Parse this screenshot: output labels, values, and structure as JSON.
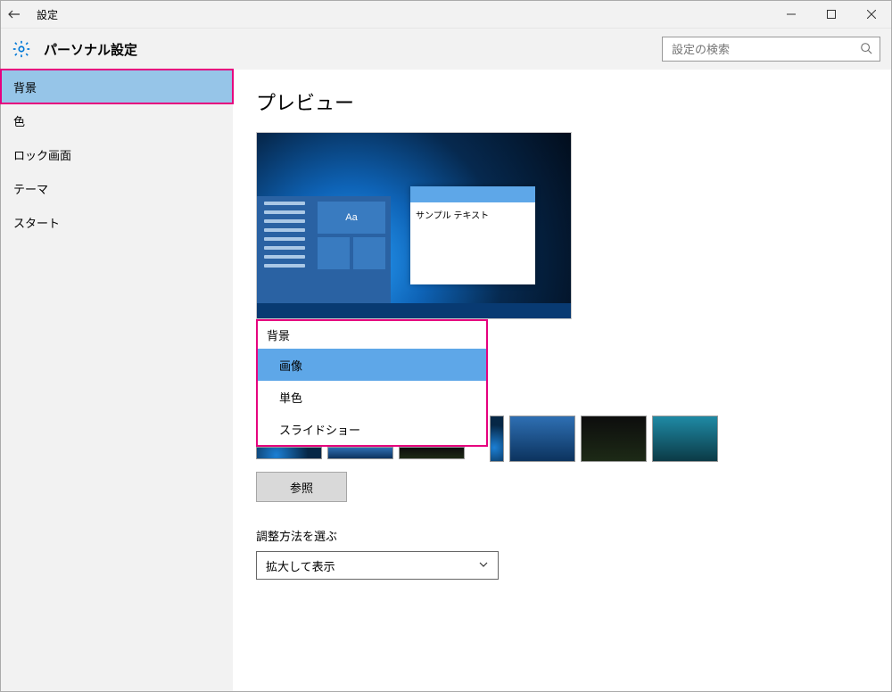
{
  "window_title": "設定",
  "header": {
    "title": "パーソナル設定",
    "search_placeholder": "設定の検索"
  },
  "sidebar": {
    "items": [
      {
        "label": "背景",
        "active": true
      },
      {
        "label": "色"
      },
      {
        "label": "ロック画面"
      },
      {
        "label": "テーマ"
      },
      {
        "label": "スタート"
      }
    ]
  },
  "content": {
    "preview": {
      "heading": "プレビュー",
      "sample_text": "サンプル テキスト",
      "tile_glyph": "Aa"
    },
    "background": {
      "label": "背景",
      "options": [
        "画像",
        "単色",
        "スライドショー"
      ],
      "selected_index": 0,
      "browse_label": "参照"
    },
    "fit": {
      "label": "調整方法を選ぶ",
      "selected": "拡大して表示"
    }
  },
  "colors": {
    "highlight": "#5ea7e8",
    "sidebar_active": "#96c5e8",
    "annotation": "#e6007e"
  }
}
